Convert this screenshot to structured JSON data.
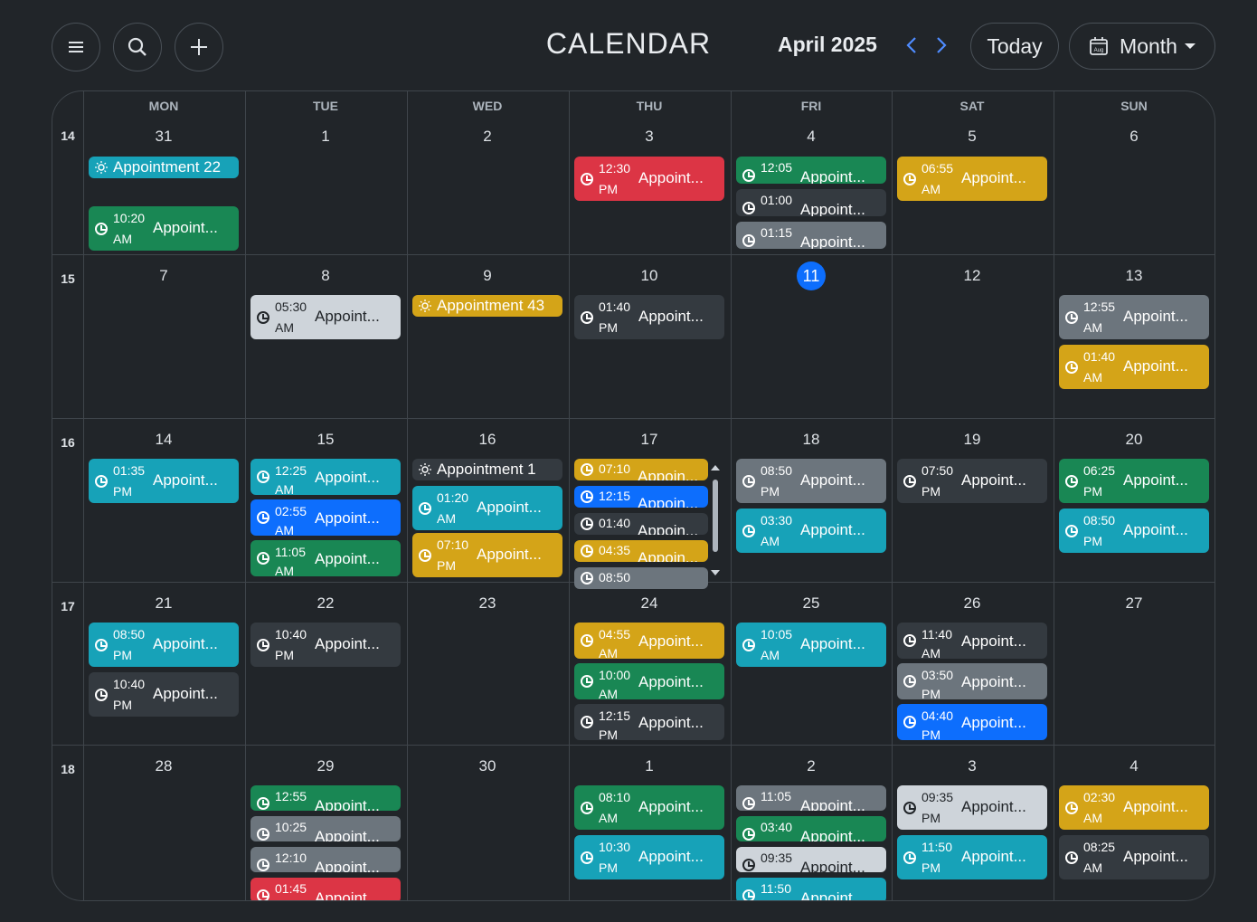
{
  "header": {
    "title": "CALENDAR",
    "period": "April 2025",
    "today_label": "Today",
    "view_label": "Month",
    "view_icon_text": "Aug"
  },
  "colors": {
    "teal": "#17a2b8",
    "green": "#198754",
    "red": "#dc3545",
    "dark": "#343a40",
    "gray": "#6c757d",
    "yellow": "#d4a418",
    "blue": "#0d6efd",
    "light": "#ced4da"
  },
  "days": [
    "MON",
    "TUE",
    "WED",
    "THU",
    "FRI",
    "SAT",
    "SUN"
  ],
  "weeks": [
    {
      "num": "14",
      "dates": [
        "31",
        "1",
        "2",
        "3",
        "4",
        "5",
        "6"
      ]
    },
    {
      "num": "15",
      "dates": [
        "7",
        "8",
        "9",
        "10",
        "11",
        "12",
        "13"
      ]
    },
    {
      "num": "16",
      "dates": [
        "14",
        "15",
        "16",
        "17",
        "18",
        "19",
        "20"
      ]
    },
    {
      "num": "17",
      "dates": [
        "21",
        "22",
        "23",
        "24",
        "25",
        "26",
        "27"
      ]
    },
    {
      "num": "18",
      "dates": [
        "28",
        "29",
        "30",
        "1",
        "2",
        "3",
        "4"
      ]
    }
  ],
  "today": "11",
  "events": [
    {
      "w": 0,
      "d": 0,
      "s": 0,
      "allday": true,
      "color": "teal",
      "label": "Appointment 22"
    },
    {
      "w": 0,
      "d": 0,
      "s": 1,
      "t1": "10:20",
      "t2": "AM",
      "color": "green",
      "label": "Appoint..."
    },
    {
      "w": 0,
      "d": 3,
      "s": 0,
      "t1": "12:30",
      "t2": "PM",
      "color": "red",
      "label": "Appoint..."
    },
    {
      "w": 0,
      "d": 4,
      "s": 0,
      "t1": "12:05",
      "t2": "",
      "color": "green",
      "label": "Appoint...",
      "mini": true
    },
    {
      "w": 0,
      "d": 4,
      "s": 1,
      "t1": "01:00",
      "t2": "",
      "color": "dark",
      "label": "Appoint...",
      "mini": true
    },
    {
      "w": 0,
      "d": 4,
      "s": 2,
      "t1": "01:15",
      "t2": "",
      "color": "gray",
      "label": "Appoint...",
      "mini": true
    },
    {
      "w": 0,
      "d": 5,
      "s": 0,
      "t1": "06:55",
      "t2": "AM",
      "color": "yellow",
      "label": "Appoint..."
    },
    {
      "w": 1,
      "d": 1,
      "s": 0,
      "t1": "05:30",
      "t2": "AM",
      "color": "light",
      "label": "Appoint..."
    },
    {
      "w": 1,
      "d": 2,
      "s": 0,
      "allday": true,
      "color": "yellow",
      "label": "Appointment 43"
    },
    {
      "w": 1,
      "d": 3,
      "s": 0,
      "t1": "01:40",
      "t2": "PM",
      "color": "dark",
      "label": "Appoint..."
    },
    {
      "w": 1,
      "d": 6,
      "s": 0,
      "t1": "12:55",
      "t2": "AM",
      "color": "gray",
      "label": "Appoint..."
    },
    {
      "w": 1,
      "d": 6,
      "s": 1,
      "t1": "01:40",
      "t2": "AM",
      "color": "yellow",
      "label": "Appoint..."
    },
    {
      "w": 2,
      "d": 0,
      "s": 0,
      "t1": "01:35",
      "t2": "PM",
      "color": "teal",
      "label": "Appoint..."
    },
    {
      "w": 2,
      "d": 1,
      "s": 0,
      "t1": "12:25",
      "t2": "AM",
      "color": "teal",
      "label": "Appoint...",
      "compact": true
    },
    {
      "w": 2,
      "d": 1,
      "s": 1,
      "t1": "02:55",
      "t2": "AM",
      "color": "blue",
      "label": "Appoint...",
      "compact": true
    },
    {
      "w": 2,
      "d": 1,
      "s": 2,
      "t1": "11:05",
      "t2": "AM",
      "color": "green",
      "label": "Appoint...",
      "compact": true
    },
    {
      "w": 2,
      "d": 2,
      "s": 0,
      "allday": true,
      "color": "dark",
      "label": "Appointment 1"
    },
    {
      "w": 2,
      "d": 2,
      "s": 1,
      "t1": "01:20",
      "t2": "AM",
      "color": "teal",
      "label": "Appoint...",
      "offset": 30
    },
    {
      "w": 2,
      "d": 2,
      "s": 2,
      "t1": "07:10",
      "t2": "PM",
      "color": "yellow",
      "label": "Appoint...",
      "offset": 30
    },
    {
      "w": 2,
      "d": 3,
      "s": 0,
      "t1": "07:10",
      "t2": "",
      "color": "yellow",
      "label": "Appoin...",
      "thu": true
    },
    {
      "w": 2,
      "d": 3,
      "s": 1,
      "t1": "12:15",
      "t2": "",
      "color": "blue",
      "label": "Appoin...",
      "thu": true
    },
    {
      "w": 2,
      "d": 3,
      "s": 2,
      "t1": "01:40",
      "t2": "",
      "color": "dark",
      "label": "Appoin...",
      "thu": true
    },
    {
      "w": 2,
      "d": 3,
      "s": 3,
      "t1": "04:35",
      "t2": "",
      "color": "yellow",
      "label": "Appoin...",
      "thu": true
    },
    {
      "w": 2,
      "d": 3,
      "s": 4,
      "t1": "08:50",
      "t2": "",
      "color": "gray",
      "label": "",
      "thu": true
    },
    {
      "w": 2,
      "d": 4,
      "s": 0,
      "t1": "08:50",
      "t2": "PM",
      "color": "gray",
      "label": "Appoint..."
    },
    {
      "w": 2,
      "d": 4,
      "s": 1,
      "t1": "03:30",
      "t2": "AM",
      "color": "teal",
      "label": "Appoint..."
    },
    {
      "w": 2,
      "d": 5,
      "s": 0,
      "t1": "07:50",
      "t2": "PM",
      "color": "dark",
      "label": "Appoint..."
    },
    {
      "w": 2,
      "d": 6,
      "s": 0,
      "t1": "06:25",
      "t2": "PM",
      "color": "green",
      "label": "Appoint..."
    },
    {
      "w": 2,
      "d": 6,
      "s": 1,
      "t1": "08:50",
      "t2": "PM",
      "color": "teal",
      "label": "Appoint..."
    },
    {
      "w": 3,
      "d": 0,
      "s": 0,
      "t1": "08:50",
      "t2": "PM",
      "color": "teal",
      "label": "Appoint..."
    },
    {
      "w": 3,
      "d": 0,
      "s": 1,
      "t1": "10:40",
      "t2": "PM",
      "color": "dark",
      "label": "Appoint..."
    },
    {
      "w": 3,
      "d": 1,
      "s": 0,
      "t1": "10:40",
      "t2": "PM",
      "color": "dark",
      "label": "Appoint..."
    },
    {
      "w": 3,
      "d": 3,
      "s": 0,
      "t1": "04:55",
      "t2": "AM",
      "color": "yellow",
      "label": "Appoint...",
      "compact": true
    },
    {
      "w": 3,
      "d": 3,
      "s": 1,
      "t1": "10:00",
      "t2": "AM",
      "color": "green",
      "label": "Appoint...",
      "compact": true
    },
    {
      "w": 3,
      "d": 3,
      "s": 2,
      "t1": "12:15",
      "t2": "PM",
      "color": "dark",
      "label": "Appoint...",
      "compact": true
    },
    {
      "w": 3,
      "d": 4,
      "s": 0,
      "t1": "10:05",
      "t2": "AM",
      "color": "teal",
      "label": "Appoint..."
    },
    {
      "w": 3,
      "d": 5,
      "s": 0,
      "t1": "11:40",
      "t2": "AM",
      "color": "dark",
      "label": "Appoint...",
      "compact": true
    },
    {
      "w": 3,
      "d": 5,
      "s": 1,
      "t1": "03:50",
      "t2": "PM",
      "color": "gray",
      "label": "Appoint...",
      "compact": true
    },
    {
      "w": 3,
      "d": 5,
      "s": 2,
      "t1": "04:40",
      "t2": "PM",
      "color": "blue",
      "label": "Appoint...",
      "compact": true
    },
    {
      "w": 4,
      "d": 1,
      "s": 0,
      "t1": "12:55",
      "t2": "",
      "color": "green",
      "label": "Appoint...",
      "mini2": true
    },
    {
      "w": 4,
      "d": 1,
      "s": 1,
      "t1": "10:25",
      "t2": "",
      "color": "gray",
      "label": "Appoint...",
      "mini2": true
    },
    {
      "w": 4,
      "d": 1,
      "s": 2,
      "t1": "12:10",
      "t2": "",
      "color": "gray",
      "label": "Appoint...",
      "mini2": true
    },
    {
      "w": 4,
      "d": 1,
      "s": 3,
      "t1": "01:45",
      "t2": "",
      "color": "red",
      "label": "Appoint...",
      "mini2": true
    },
    {
      "w": 4,
      "d": 3,
      "s": 0,
      "t1": "08:10",
      "t2": "AM",
      "color": "green",
      "label": "Appoint..."
    },
    {
      "w": 4,
      "d": 3,
      "s": 1,
      "t1": "10:30",
      "t2": "PM",
      "color": "teal",
      "label": "Appoint..."
    },
    {
      "w": 4,
      "d": 4,
      "s": 0,
      "t1": "11:05",
      "t2": "",
      "color": "gray",
      "label": "Appoint...",
      "mini2": true
    },
    {
      "w": 4,
      "d": 4,
      "s": 1,
      "t1": "03:40",
      "t2": "",
      "color": "green",
      "label": "Appoint...",
      "mini2": true
    },
    {
      "w": 4,
      "d": 4,
      "s": 2,
      "t1": "09:35",
      "t2": "",
      "color": "light",
      "label": "Appoint...",
      "mini2": true
    },
    {
      "w": 4,
      "d": 4,
      "s": 3,
      "t1": "11:50",
      "t2": "",
      "color": "teal",
      "label": "Appoint...",
      "mini2": true
    },
    {
      "w": 4,
      "d": 5,
      "s": 0,
      "t1": "09:35",
      "t2": "PM",
      "color": "light",
      "label": "Appoint..."
    },
    {
      "w": 4,
      "d": 5,
      "s": 1,
      "t1": "11:50",
      "t2": "PM",
      "color": "teal",
      "label": "Appoint..."
    },
    {
      "w": 4,
      "d": 6,
      "s": 0,
      "t1": "02:30",
      "t2": "AM",
      "color": "yellow",
      "label": "Appoint..."
    },
    {
      "w": 4,
      "d": 6,
      "s": 1,
      "t1": "08:25",
      "t2": "AM",
      "color": "dark",
      "label": "Appoint..."
    }
  ]
}
